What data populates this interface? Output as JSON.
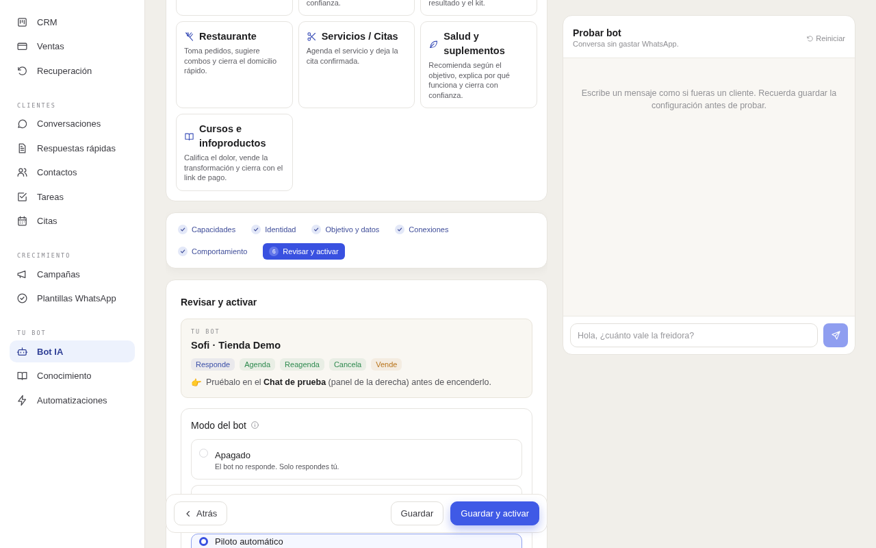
{
  "sidebar": {
    "groups": [
      {
        "items": [
          {
            "label": "CRM",
            "selected": false
          },
          {
            "label": "Ventas",
            "selected": false
          },
          {
            "label": "Recuperación",
            "selected": false
          }
        ]
      },
      {
        "title": "CLIENTES",
        "items": [
          {
            "label": "Conversaciones",
            "selected": false
          },
          {
            "label": "Respuestas rápidas",
            "selected": false
          },
          {
            "label": "Contactos",
            "selected": false
          },
          {
            "label": "Tareas",
            "selected": false
          },
          {
            "label": "Citas",
            "selected": false
          }
        ]
      },
      {
        "title": "CRECIMIENTO",
        "items": [
          {
            "label": "Campañas",
            "selected": false
          },
          {
            "label": "Plantillas WhatsApp",
            "selected": false
          }
        ]
      },
      {
        "title": "TU BOT",
        "items": [
          {
            "label": "Bot IA",
            "selected": true
          },
          {
            "label": "Conocimiento",
            "selected": false
          },
          {
            "label": "Automatizaciones",
            "selected": false
          }
        ]
      }
    ]
  },
  "templates": [
    {
      "kind": "partial"
    },
    {
      "kind": "partial",
      "description": "confianza."
    },
    {
      "kind": "partial",
      "description": "resultado y el kit."
    },
    {
      "title": "Restaurante",
      "description": "Toma pedidos, sugiere combos y cierra el domicilio rápido."
    },
    {
      "title": "Servicios / Citas",
      "description": "Agenda el servicio y deja la cita confirmada."
    },
    {
      "title": "Salud y suplementos",
      "description": "Recomienda según el objetivo, explica por qué funciona y cierra con confianza."
    },
    {
      "title": "Cursos e infoproductos",
      "description": "Califica el dolor, vende la transformación y cierra con el link de pago."
    }
  ],
  "steps": [
    {
      "label": "Capacidades",
      "done": true,
      "selected": false
    },
    {
      "label": "Identidad",
      "done": true,
      "selected": false
    },
    {
      "label": "Objetivo y datos",
      "done": true,
      "selected": false
    },
    {
      "label": "Conexiones",
      "done": true,
      "selected": false
    },
    {
      "label": "Comportamiento",
      "done": true,
      "selected": false
    },
    {
      "label": "Revisar y activar",
      "number": "6",
      "done": false,
      "selected": true
    }
  ],
  "review": {
    "title": "Revisar y activar",
    "summary": {
      "eyebrow": "TU BOT",
      "name": "Sofi · Tienda Demo",
      "tags": [
        {
          "label": "Responde",
          "color": "#3b4fa8"
        },
        {
          "label": "Agenda",
          "color": "#2e8a4f"
        },
        {
          "label": "Reagenda",
          "color": "#2e8a4f"
        },
        {
          "label": "Cancela",
          "color": "#2e8a4f"
        },
        {
          "label": "Vende",
          "color": "#b9741c"
        }
      ],
      "emoji": "👉",
      "note": "Pruébalo en el **Chat de prueba** (panel de la derecha) antes de encenderlo."
    },
    "mode": {
      "title": "Modo del bot",
      "options": [
        {
          "label": "Apagado",
          "description": "El bot no responde. Solo respondes tú.",
          "selected": false
        },
        {
          "label": "Piloto automático",
          "selected": true
        }
      ]
    }
  },
  "footer": {
    "back": "Atrás",
    "save": "Guardar",
    "save_activate": "Guardar y activar"
  },
  "chat": {
    "title": "Probar bot",
    "subtitle": "Conversa sin gastar WhatsApp.",
    "reset": "Reiniciar",
    "hint": "Escribe un mensaje como si fueras un cliente. Recuerda guardar la configuración antes de probar.",
    "placeholder": "Hola, ¿cuánto vale la freidora?"
  }
}
